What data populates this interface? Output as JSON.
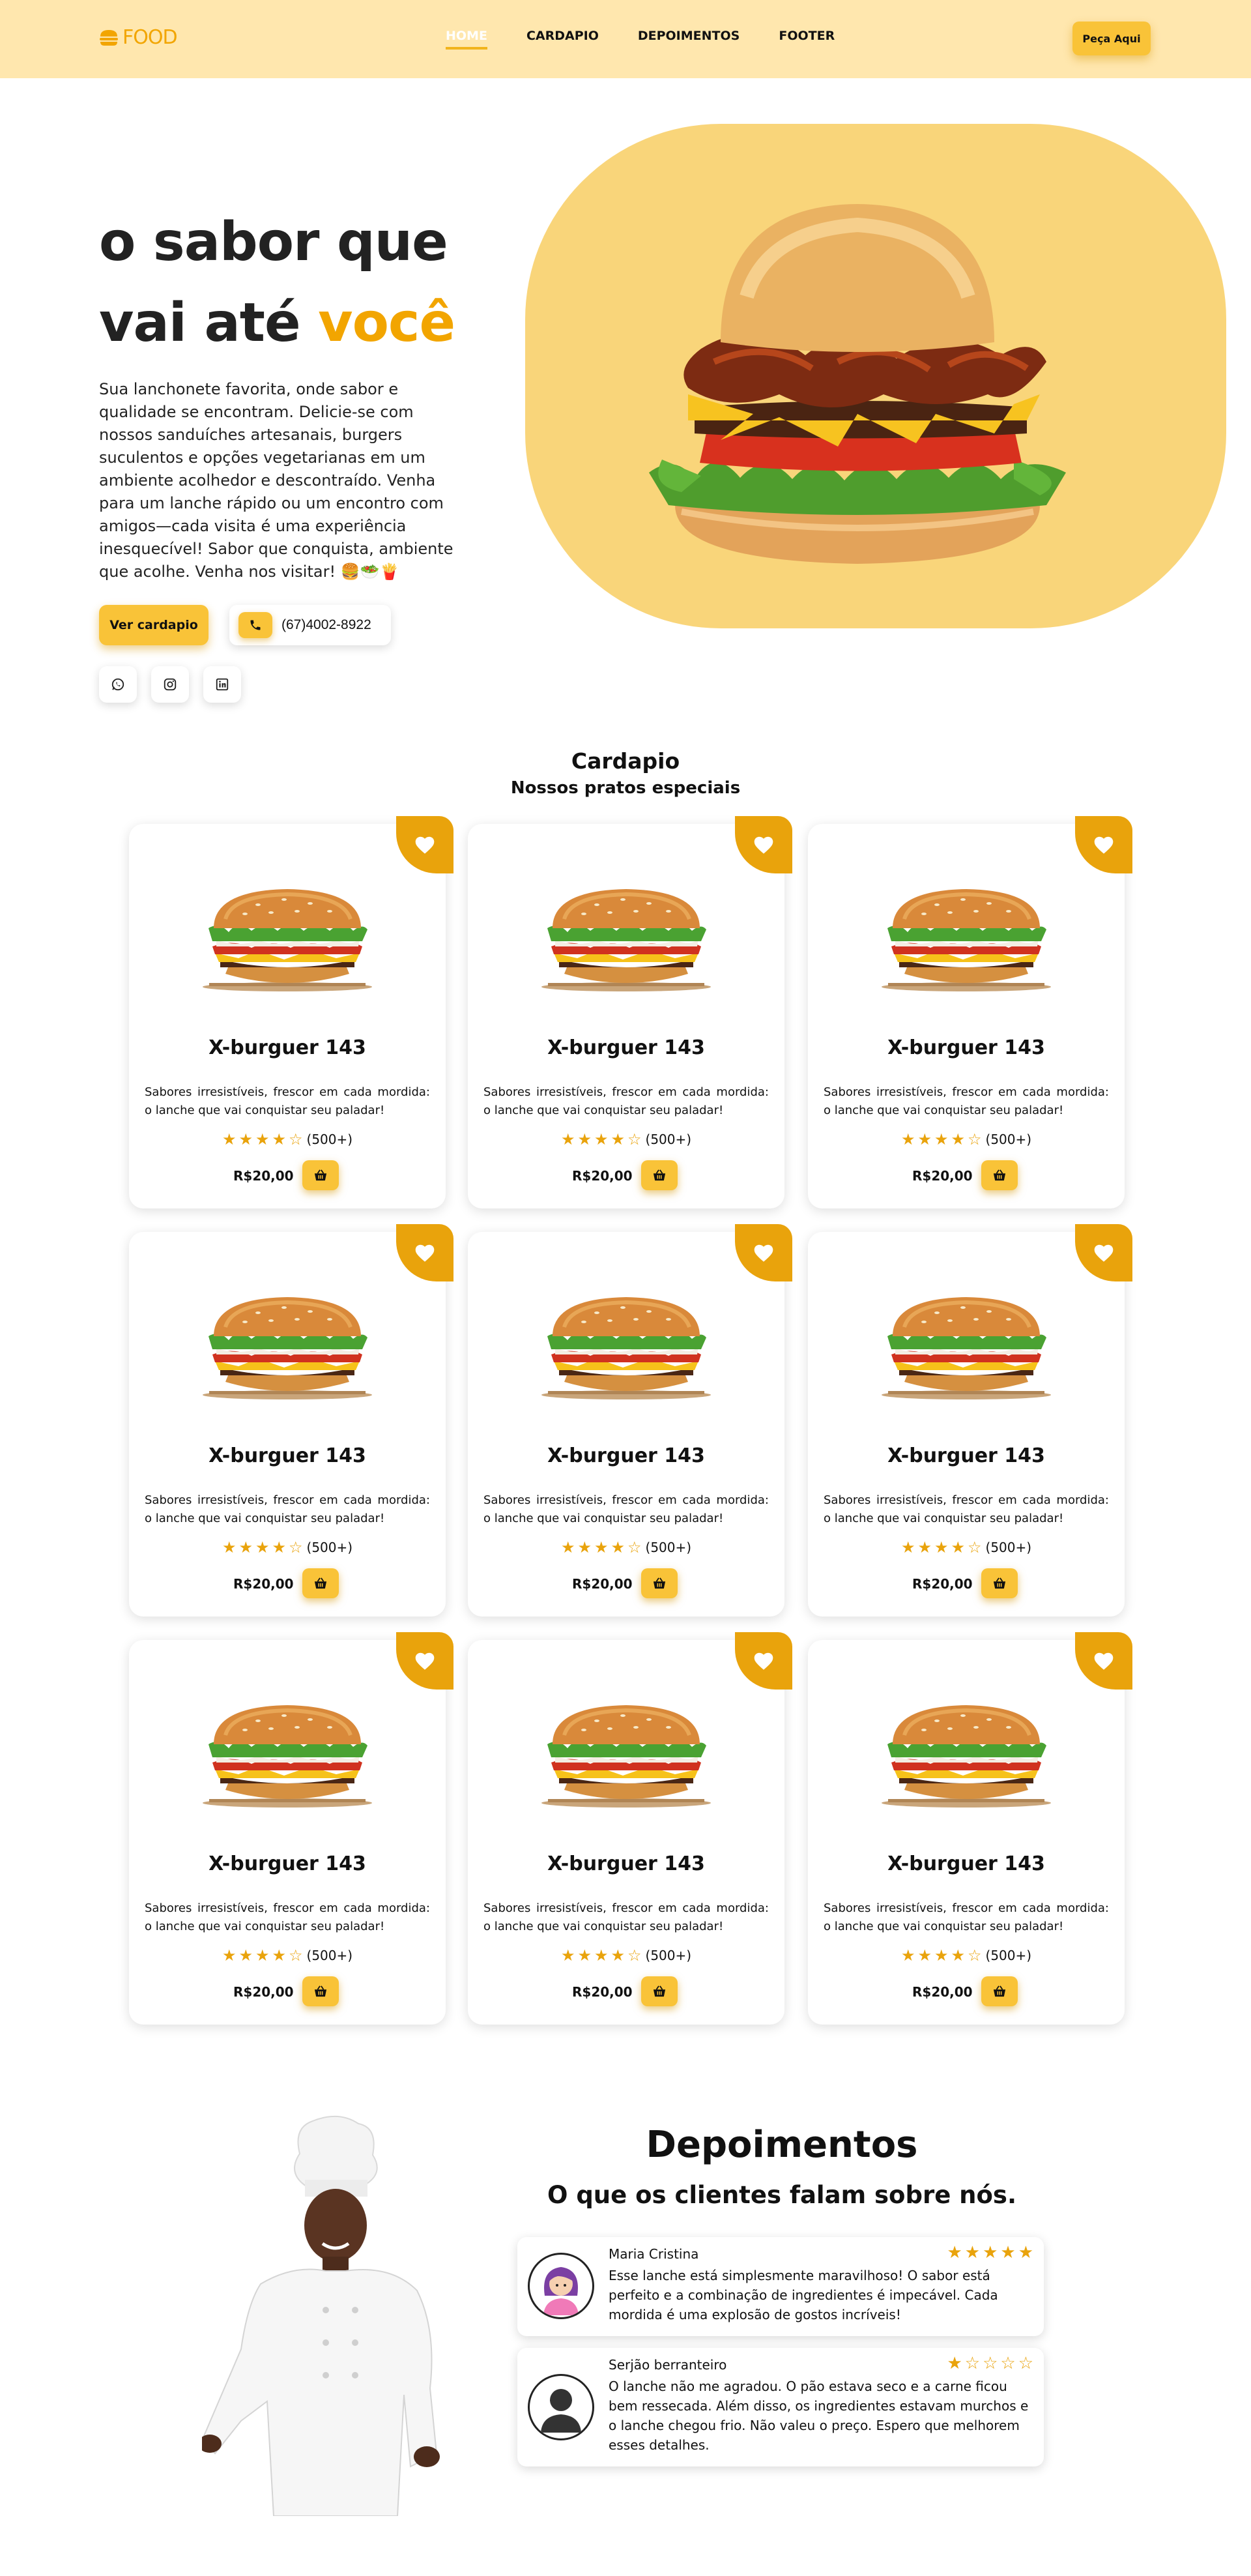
{
  "header": {
    "logo_text": "FOOD",
    "nav": [
      {
        "label": "HOME",
        "active": true
      },
      {
        "label": "CARDAPIO",
        "active": false
      },
      {
        "label": "DEPOIMENTOS",
        "active": false
      },
      {
        "label": "FOOTER",
        "active": false
      }
    ],
    "order_button": "Peça Aqui"
  },
  "hero": {
    "title_line1": "o sabor que",
    "title_line2_prefix": "vai até ",
    "title_line2_accent": "você",
    "description": "Sua lanchonete favorita, onde sabor e qualidade se encontram. Delicie-se com nossos sanduíches artesanais, burgers suculentos e opções vegetarianas em um ambiente acolhedor e descontraído. Venha para um lanche rápido ou um encontro com amigos—cada visita é uma experiência inesquecível! Sabor que conquista, ambiente que acolhe. Venha nos visitar! 🍔🥗🍟",
    "menu_button": "Ver cardapio",
    "phone": "(67)4002-8922",
    "socials": [
      "whatsapp-icon",
      "instagram-icon",
      "linkedin-icon"
    ]
  },
  "menu": {
    "title": "Cardapio",
    "subtitle": "Nossos pratos especiais",
    "items": [
      {
        "name": "X-burguer 143",
        "description": "Sabores irresistíveis, frescor em cada mordida: o lanche que vai conquistar seu paladar!",
        "rating": 4,
        "count": "(500+)",
        "price": "R$20,00"
      },
      {
        "name": "X-burguer 143",
        "description": "Sabores irresistíveis, frescor em cada mordida: o lanche que vai conquistar seu paladar!",
        "rating": 4,
        "count": "(500+)",
        "price": "R$20,00"
      },
      {
        "name": "X-burguer 143",
        "description": "Sabores irresistíveis, frescor em cada mordida: o lanche que vai conquistar seu paladar!",
        "rating": 4,
        "count": "(500+)",
        "price": "R$20,00"
      },
      {
        "name": "X-burguer 143",
        "description": "Sabores irresistíveis, frescor em cada mordida: o lanche que vai conquistar seu paladar!",
        "rating": 4,
        "count": "(500+)",
        "price": "R$20,00"
      },
      {
        "name": "X-burguer 143",
        "description": "Sabores irresistíveis, frescor em cada mordida: o lanche que vai conquistar seu paladar!",
        "rating": 4,
        "count": "(500+)",
        "price": "R$20,00"
      },
      {
        "name": "X-burguer 143",
        "description": "Sabores irresistíveis, frescor em cada mordida: o lanche que vai conquistar seu paladar!",
        "rating": 4,
        "count": "(500+)",
        "price": "R$20,00"
      },
      {
        "name": "X-burguer 143",
        "description": "Sabores irresistíveis, frescor em cada mordida: o lanche que vai conquistar seu paladar!",
        "rating": 4,
        "count": "(500+)",
        "price": "R$20,00"
      },
      {
        "name": "X-burguer 143",
        "description": "Sabores irresistíveis, frescor em cada mordida: o lanche que vai conquistar seu paladar!",
        "rating": 4,
        "count": "(500+)",
        "price": "R$20,00"
      },
      {
        "name": "X-burguer 143",
        "description": "Sabores irresistíveis, frescor em cada mordida: o lanche que vai conquistar seu paladar!",
        "rating": 4,
        "count": "(500+)",
        "price": "R$20,00"
      }
    ]
  },
  "testimonials": {
    "title": "Depoimentos",
    "subtitle": "O que os clientes falam sobre nós.",
    "reviews": [
      {
        "name": "Maria Cristina",
        "rating": 5,
        "text": "Esse lanche está simplesmente maravilhoso! O sabor está perfeito e a combinação de ingredientes é impecável. Cada mordida é uma explosão de gostos incríveis!"
      },
      {
        "name": "Serjão berranteiro",
        "rating": 1,
        "text": "O lanche não me agradou. O pão estava seco e a carne ficou bem ressecada. Além disso, os ingredientes estavam murchos e o lanche chegou frio. Não valeu o preço. Espero que melhorem esses detalhes."
      }
    ]
  },
  "colors": {
    "header_bg": "#ffe7ae",
    "accent": "#f2a500",
    "button": "#f9c338",
    "blob": "#f9d57a",
    "favorite": "#e9a30c"
  }
}
